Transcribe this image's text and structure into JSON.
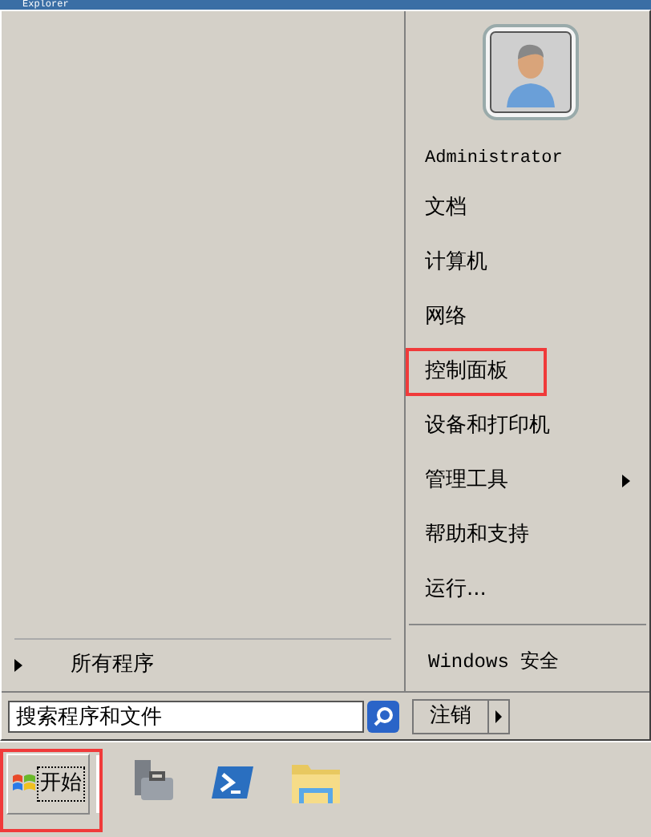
{
  "window": {
    "title": "Explorer"
  },
  "user": {
    "name": "Administrator"
  },
  "right_items": [
    {
      "label": "文档",
      "kind": "plain",
      "highlighted": false
    },
    {
      "label": "计算机",
      "kind": "plain",
      "highlighted": false
    },
    {
      "label": "网络",
      "kind": "plain",
      "highlighted": false
    },
    {
      "label": "控制面板",
      "kind": "plain",
      "highlighted": true
    },
    {
      "label": "设备和打印机",
      "kind": "plain",
      "highlighted": false
    },
    {
      "label": "管理工具",
      "kind": "submenu",
      "highlighted": false
    },
    {
      "label": "帮助和支持",
      "kind": "plain",
      "highlighted": false
    },
    {
      "label": "运行...",
      "kind": "plain",
      "highlighted": false
    },
    {
      "label": "Windows 安全",
      "kind": "separated",
      "highlighted": false
    }
  ],
  "all_programs": {
    "label": "所有程序"
  },
  "search": {
    "value": "搜索程序和文件"
  },
  "logoff": {
    "label": "注销"
  },
  "taskbar": {
    "start": {
      "label": "开始",
      "highlighted": true
    }
  }
}
